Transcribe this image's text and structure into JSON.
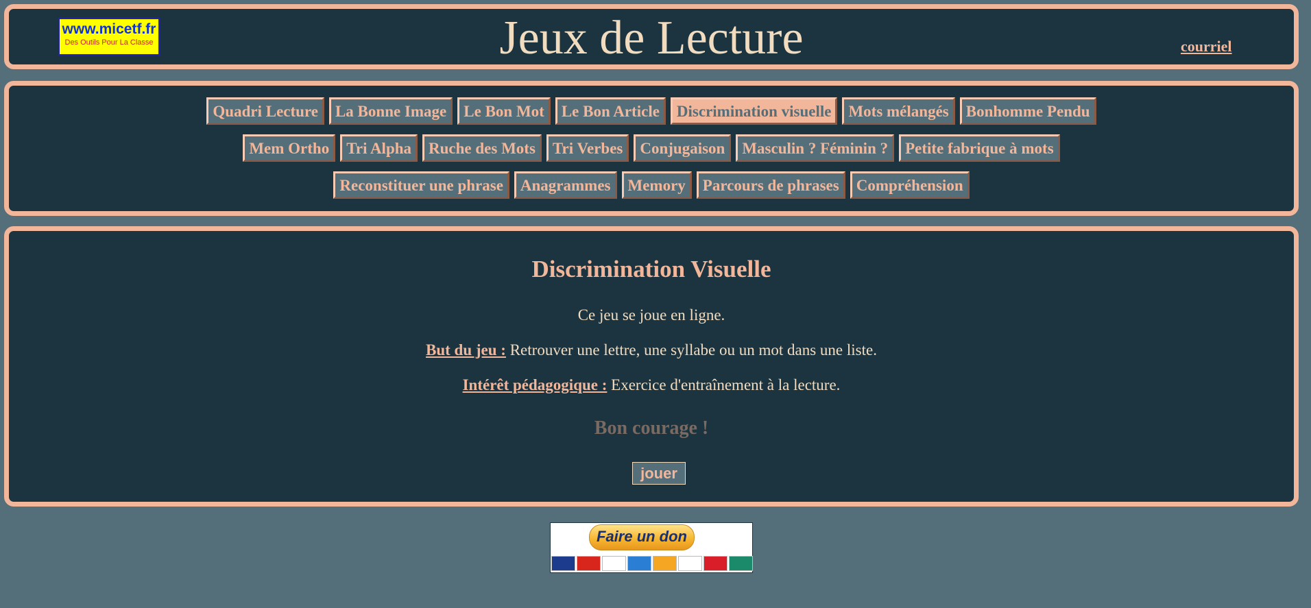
{
  "header": {
    "logo_text": "www.micetf.fr",
    "logo_tagline": "Des Outils Pour La Classe",
    "title": "Jeux de Lecture",
    "contact_link": "courriel"
  },
  "nav": {
    "rows": [
      [
        "Quadri Lecture",
        "La Bonne Image",
        "Le Bon Mot",
        "Le Bon Article",
        "Discrimination visuelle",
        "Mots mélangés",
        "Bonhomme Pendu"
      ],
      [
        "Mem Ortho",
        "Tri Alpha",
        "Ruche des Mots",
        "Tri Verbes",
        "Conjugaison",
        "Masculin ? Féminin ?",
        "Petite fabrique à mots"
      ],
      [
        "Reconstituer une phrase",
        "Anagrammes",
        "Memory",
        "Parcours de phrases",
        "Compréhension"
      ]
    ],
    "active": "Discrimination visuelle"
  },
  "main": {
    "title": "Discrimination Visuelle",
    "intro": "Ce jeu se joue en ligne.",
    "goal_label": "But du jeu :",
    "goal_text": " Retrouver une lettre, une syllabe ou un mot dans une liste.",
    "interest_label": "Intérêt pédagogique :",
    "interest_text": " Exercice d'entraînement à la lecture.",
    "encouragement": "Bon courage !",
    "play_button": "jouer"
  },
  "donate": {
    "button_label": "Faire un don",
    "cards": [
      {
        "icon": "maestro-card-icon",
        "color": "#1d3b8c"
      },
      {
        "icon": "mastercard-icon",
        "color": "#d9261c"
      },
      {
        "icon": "visa-card-icon",
        "color": "#ffffff"
      },
      {
        "icon": "amex-card-icon",
        "color": "#2a7fd4"
      },
      {
        "icon": "aurore-card-icon",
        "color": "#f5a623"
      },
      {
        "icon": "cofinoga-card-icon",
        "color": "#ffffff"
      },
      {
        "icon": "4-etoiles-card-icon",
        "color": "#d91e2a"
      },
      {
        "icon": "cb-card-icon",
        "color": "#1b8a6b"
      }
    ]
  },
  "colors": {
    "background": "#546e7a",
    "panel": "#1b3440",
    "accent": "#f2b79a",
    "text": "#f2dcc0"
  }
}
